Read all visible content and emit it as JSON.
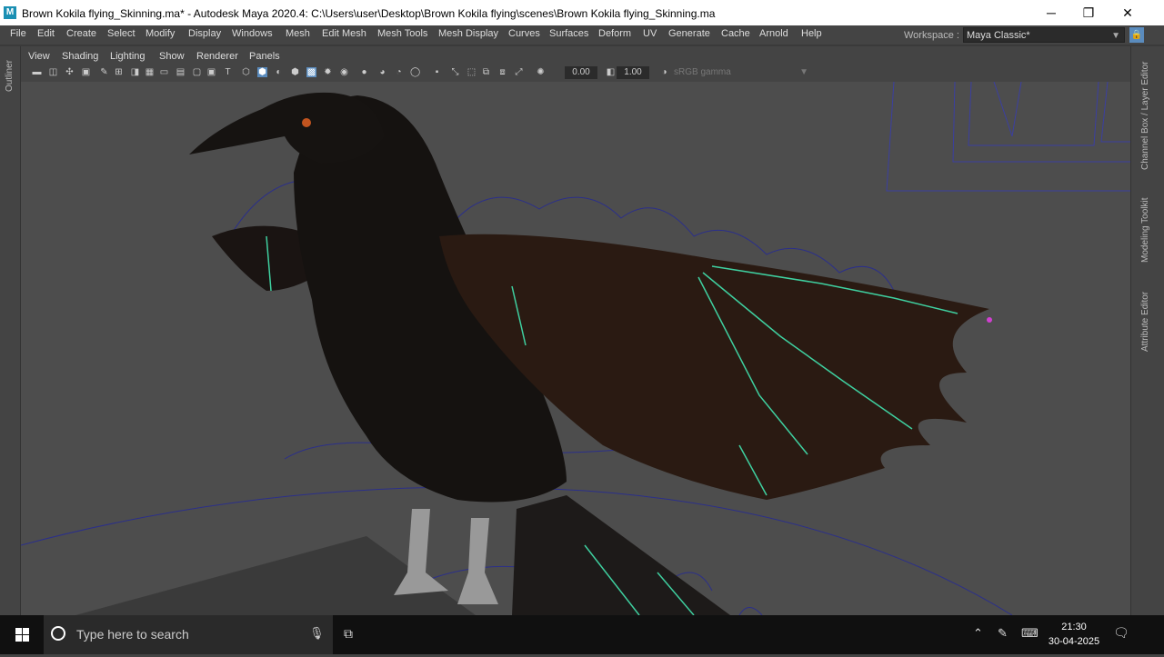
{
  "titlebar": {
    "title": "Brown Kokila flying_Skinning.ma* - Autodesk Maya 2020.4: C:\\Users\\user\\Desktop\\Brown Kokila flying\\scenes\\Brown Kokila flying_Skinning.ma",
    "app_icon": "M",
    "minimize": "─",
    "maximize": "❐",
    "close": "✕"
  },
  "menubar": {
    "items": [
      "File",
      "Edit",
      "Create",
      "Select",
      "Modify",
      "Display",
      "Windows",
      "Mesh",
      "Edit Mesh",
      "Mesh Tools",
      "Mesh Display",
      "Curves",
      "Surfaces",
      "Deform",
      "UV",
      "Generate",
      "Cache",
      "Arnold",
      "Help"
    ],
    "workspace_label": "Workspace :",
    "workspace_value": "Maya Classic*"
  },
  "left_dock": {
    "label": "Outliner"
  },
  "right_dock": {
    "labels": [
      "Channel Box / Layer Editor",
      "Modeling Toolkit",
      "Attribute Editor"
    ]
  },
  "panel_menu": {
    "items": [
      "View",
      "Shading",
      "Lighting",
      "Show",
      "Renderer",
      "Panels"
    ]
  },
  "toolbar": {
    "exposure": "0.00",
    "gamma": "1.00",
    "color_space": "sRGB gamma"
  },
  "taskbar": {
    "search_placeholder": "Type here to search",
    "time": "21:30",
    "date": "30-04-2025"
  },
  "colors": {
    "bird": "#151210",
    "wing": "#2a1a12",
    "curves": "#2b2f8a",
    "joints": "#3fd0a0",
    "accent": "#5a8bbd"
  }
}
